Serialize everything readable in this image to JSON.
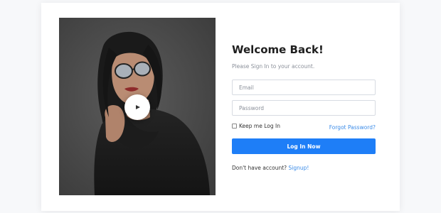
{
  "login": {
    "title": "Welcome Back!",
    "subtitle": "Please Sign In to your account.",
    "email_placeholder": "Email",
    "password_placeholder": "Password",
    "remember_label": "Keep me Log In",
    "forgot_label": "Forgot Password?",
    "submit_label": "Log In Now",
    "no_account_text": "Don't have account?",
    "signup_label": "Signup!"
  },
  "icons": {
    "media": "play-icon"
  },
  "colors": {
    "accent": "#1e7ef7",
    "link": "#3a8be8"
  }
}
